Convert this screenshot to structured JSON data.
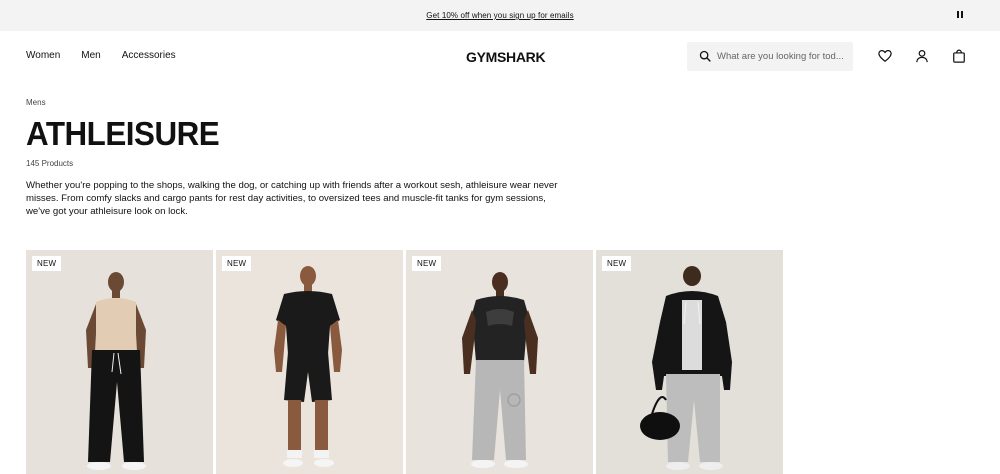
{
  "promo": {
    "text": "Get 10% off when you sign up for emails"
  },
  "nav": {
    "women": "Women",
    "men": "Men",
    "accessories": "Accessories"
  },
  "brand": {
    "logo": "GYMSHARK"
  },
  "search": {
    "placeholder": "What are you looking for tod..."
  },
  "icons": {
    "pause": "pause-icon",
    "search": "search-icon",
    "wishlist": "heart-icon",
    "account": "user-icon",
    "bag": "bag-icon"
  },
  "page": {
    "breadcrumb": "Mens",
    "title": "ATHLEISURE",
    "product_count": "145 Products",
    "description": "Whether you're popping to the shops, walking the dog, or catching up with friends after a workout sesh, athleisure wear never misses. From comfy slacks and cargo pants for rest day activities, to oversized tees and muscle-fit tanks for gym sessions, we've got your athleisure look on lock."
  },
  "products": [
    {
      "badge": "NEW",
      "bg": "#e6e1da"
    },
    {
      "badge": "NEW",
      "bg": "#eae4dd"
    },
    {
      "badge": "NEW",
      "bg": "#e8e3dc"
    },
    {
      "badge": "NEW",
      "bg": "#e3dfd9"
    }
  ],
  "colors": {
    "promo_bg": "#f3f3f3",
    "search_bg": "#f3f3f3",
    "text": "#111111"
  }
}
